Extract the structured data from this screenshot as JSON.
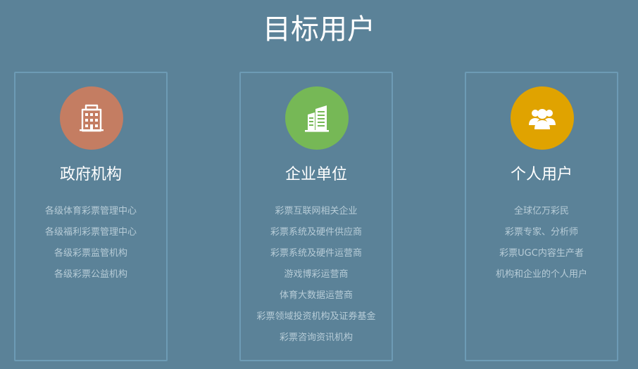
{
  "header": {
    "title": "目标用户"
  },
  "cards": [
    {
      "title": "政府机构",
      "icon": "building-icon",
      "color": "#c47d62",
      "items": [
        "各级体育彩票管理中心",
        "各级福利彩票管理中心",
        "各级彩票监管机构",
        "各级彩票公益机构"
      ]
    },
    {
      "title": "企业单位",
      "icon": "office-buildings-icon",
      "color": "#76b856",
      "items": [
        "彩票互联网相关企业",
        "彩票系统及硬件供应商",
        "彩票系统及硬件运营商",
        "游戏博彩运营商",
        "体育大数据运营商",
        "彩票领域投资机构及证券基金",
        "彩票咨询资讯机构"
      ]
    },
    {
      "title": "个人用户",
      "icon": "users-icon",
      "color": "#e0a300",
      "items": [
        "全球亿万彩民",
        "彩票专家、分析师",
        "彩票UGC内容生产者",
        "机构和企业的个人用户"
      ]
    }
  ]
}
